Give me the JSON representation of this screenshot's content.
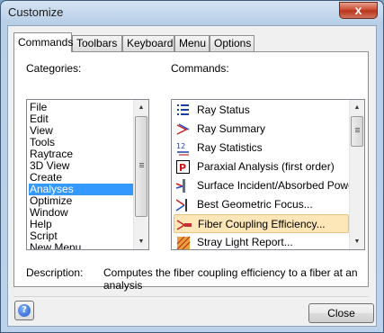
{
  "window": {
    "title": "Customize",
    "close_glyph": "x"
  },
  "tabs": [
    {
      "label": "Commands",
      "active": true
    },
    {
      "label": "Toolbars",
      "active": false
    },
    {
      "label": "Keyboard",
      "active": false
    },
    {
      "label": "Menu",
      "active": false
    },
    {
      "label": "Options",
      "active": false
    }
  ],
  "categories": {
    "label": "Categories:",
    "selected": "Analyses",
    "items": [
      "File",
      "Edit",
      "View",
      "Tools",
      "Raytrace",
      "3D View",
      "Create",
      "Analyses",
      "Optimize",
      "Window",
      "Help",
      "Script",
      "New Menu"
    ]
  },
  "commands": {
    "label": "Commands:",
    "selected": "Fiber Coupling Efficiency...",
    "items": [
      {
        "label": "Ray Status",
        "icon": "ray-status-icon"
      },
      {
        "label": "Ray Summary",
        "icon": "ray-summary-icon"
      },
      {
        "label": "Ray Statistics",
        "icon": "ray-statistics-icon"
      },
      {
        "label": "Paraxial Analysis (first order)",
        "icon": "paraxial-icon"
      },
      {
        "label": "Surface Incident/Absorbed Power",
        "icon": "surface-power-icon"
      },
      {
        "label": "Best Geometric Focus...",
        "icon": "geometric-focus-icon"
      },
      {
        "label": "Fiber Coupling Efficiency...",
        "icon": "fiber-coupling-icon"
      },
      {
        "label": "Stray Light Report...",
        "icon": "stray-light-icon"
      }
    ]
  },
  "description": {
    "label": "Description:",
    "text": "Computes the fiber coupling efficiency to a fiber at an analysis"
  },
  "buttons": {
    "help_glyph": "?",
    "close": "Close"
  }
}
